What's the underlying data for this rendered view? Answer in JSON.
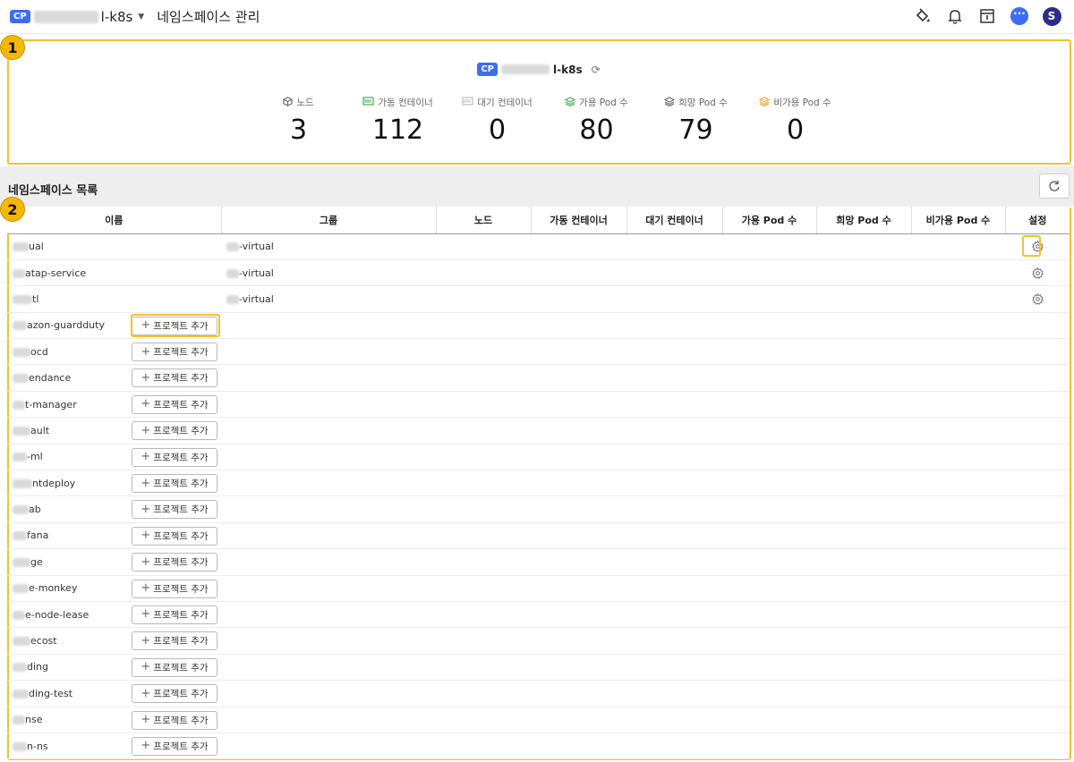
{
  "topbar": {
    "badge": "CP",
    "cluster_suffix": "l-k8s",
    "page_title": "네임스페이스 관리",
    "avatar_letter": "S",
    "chat_glyph": "···"
  },
  "callouts": {
    "one": "1",
    "two": "2"
  },
  "summary": {
    "badge": "CP",
    "cluster_suffix": "l-k8s",
    "stats": [
      {
        "label": "노드",
        "value": "3",
        "icon": "cube-icon",
        "color": "#666666"
      },
      {
        "label": "가동 컨테이너",
        "value": "112",
        "icon": "container-running-icon",
        "color": "#4caf50"
      },
      {
        "label": "대기 컨테이너",
        "value": "0",
        "icon": "container-waiting-icon",
        "color": "#bdbdbd"
      },
      {
        "label": "가용 Pod 수",
        "value": "80",
        "icon": "layers-green-icon",
        "color": "#4caf50"
      },
      {
        "label": "희망 Pod 수",
        "value": "79",
        "icon": "layers-gray-icon",
        "color": "#666666"
      },
      {
        "label": "비가용 Pod 수",
        "value": "0",
        "icon": "layers-orange-icon",
        "color": "#f0a030"
      }
    ]
  },
  "section": {
    "title": "네임스페이스 목록"
  },
  "table": {
    "columns": [
      "이름",
      "그룹",
      "노드",
      "가동 컨테이너",
      "대기 컨테이너",
      "가용 Pod 수",
      "희망 Pod 수",
      "비가용 Pod 수",
      "설정"
    ],
    "add_project_label": "프로젝트 추가",
    "rows": [
      {
        "name": "ual",
        "group": "-virtual",
        "settings": true
      },
      {
        "name": "atap-service",
        "group": "-virtual",
        "settings": true
      },
      {
        "name": "tl",
        "group": "-virtual",
        "settings": true
      },
      {
        "name": "azon-guardduty",
        "group": "",
        "settings": false
      },
      {
        "name": "ocd",
        "group": "",
        "settings": false
      },
      {
        "name": "endance",
        "group": "",
        "settings": false
      },
      {
        "name": "t-manager",
        "group": "",
        "settings": false
      },
      {
        "name": "ault",
        "group": "",
        "settings": false
      },
      {
        "name": "-ml",
        "group": "",
        "settings": false
      },
      {
        "name": "ntdeploy",
        "group": "",
        "settings": false
      },
      {
        "name": "ab",
        "group": "",
        "settings": false
      },
      {
        "name": "fana",
        "group": "",
        "settings": false
      },
      {
        "name": "ge",
        "group": "",
        "settings": false
      },
      {
        "name": "e-monkey",
        "group": "",
        "settings": false
      },
      {
        "name": "e-node-lease",
        "group": "",
        "settings": false
      },
      {
        "name": "ecost",
        "group": "",
        "settings": false
      },
      {
        "name": "ding",
        "group": "",
        "settings": false
      },
      {
        "name": "ding-test",
        "group": "",
        "settings": false
      },
      {
        "name": "nse",
        "group": "",
        "settings": false
      },
      {
        "name": "n-ns",
        "group": "",
        "settings": false
      }
    ]
  }
}
